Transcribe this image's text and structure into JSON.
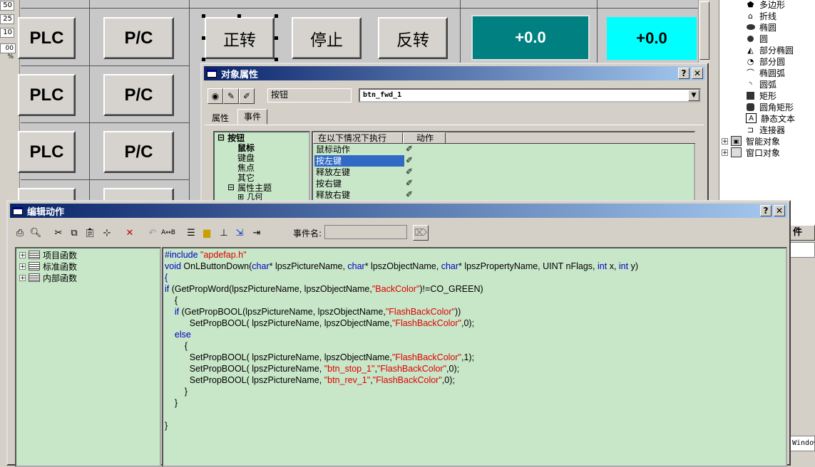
{
  "ruler": {
    "values": [
      "50",
      "25",
      "10",
      "00 %"
    ]
  },
  "canvas": {
    "left_buttons": [
      "PLC",
      "PLC",
      "PLC"
    ],
    "pc_buttons": [
      "P/C",
      "P/C",
      "P/C"
    ],
    "control_buttons": [
      "正转",
      "停止",
      "反转"
    ],
    "displays": [
      {
        "value": "+0.0",
        "color": "#008080"
      },
      {
        "value": "+0.0",
        "color": "#00ffff"
      }
    ]
  },
  "palette": {
    "items": [
      {
        "label": "多边形",
        "icon": "polygon-icon"
      },
      {
        "label": "折线",
        "icon": "polyline-icon"
      },
      {
        "label": "椭圆",
        "icon": "ellipse-icon"
      },
      {
        "label": "圆",
        "icon": "circle-icon"
      },
      {
        "label": "部分椭圆",
        "icon": "partial-ellipse-icon"
      },
      {
        "label": "部分圆",
        "icon": "partial-circle-icon"
      },
      {
        "label": "椭圆弧",
        "icon": "ellipse-arc-icon"
      },
      {
        "label": "圆弧",
        "icon": "arc-icon"
      },
      {
        "label": "矩形",
        "icon": "rectangle-icon"
      },
      {
        "label": "圆角矩形",
        "icon": "rounded-rectangle-icon"
      },
      {
        "label": "静态文本",
        "icon": "static-text-icon"
      },
      {
        "label": "连接器",
        "icon": "connector-icon"
      }
    ],
    "groups": [
      {
        "label": "智能对象"
      },
      {
        "label": "窗口对象"
      }
    ],
    "partial_tab": "件",
    "partial_window_label": "Window"
  },
  "object_props": {
    "title": "对象属性",
    "help_btn": "?",
    "close_btn": "✕",
    "object_type": "按钮",
    "object_name": "btn_fwd_1",
    "tabs": [
      "属性",
      "事件"
    ],
    "active_tab": "事件",
    "tree": {
      "root": "按钮",
      "children": [
        "鼠标",
        "键盘",
        "焦点",
        "其它",
        "属性主题"
      ],
      "sub": "几何"
    },
    "events_header": {
      "condition": "在以下情况下执行",
      "action": "动作"
    },
    "events": [
      "鼠标动作",
      "按左键",
      "释放左键",
      "按右键",
      "释放右键"
    ],
    "selected_event": "按左键"
  },
  "edit_action": {
    "title": "编辑动作",
    "help_btn": "?",
    "close_btn": "✕",
    "event_name_label": "事件名:",
    "event_name_value": "",
    "tree": [
      "项目函数",
      "标准函数",
      "内部函数"
    ],
    "code": [
      [
        [
          "d",
          "#include "
        ],
        [
          "s",
          "\"apdefap.h\""
        ]
      ],
      [
        [
          "k",
          "void"
        ],
        [
          "t",
          " OnLButtonDown("
        ],
        [
          "k",
          "char"
        ],
        [
          "t",
          "* lpszPictureName, "
        ],
        [
          "k",
          "char"
        ],
        [
          "t",
          "* lpszObjectName, "
        ],
        [
          "k",
          "char"
        ],
        [
          "t",
          "* lpszPropertyName, UINT nFlags, "
        ],
        [
          "k",
          "int"
        ],
        [
          "t",
          " x, "
        ],
        [
          "k",
          "int"
        ],
        [
          "t",
          " y)"
        ]
      ],
      [
        [
          "k",
          "{"
        ]
      ],
      [
        [
          "k",
          "if"
        ],
        [
          "t",
          " (GetPropWord(lpszPictureName, lpszObjectName,"
        ],
        [
          "s",
          "\"BackColor\""
        ],
        [
          "t",
          ")!=CO_GREEN)"
        ]
      ],
      [
        [
          "t",
          "    {"
        ]
      ],
      [
        [
          "t",
          "    "
        ],
        [
          "k",
          "if"
        ],
        [
          "t",
          " (GetPropBOOL(lpszPictureName, lpszObjectName,"
        ],
        [
          "s",
          "\"FlashBackColor\""
        ],
        [
          "t",
          "))"
        ]
      ],
      [
        [
          "t",
          "          SetPropBOOL( lpszPictureName, lpszObjectName,"
        ],
        [
          "s",
          "\"FlashBackColor\""
        ],
        [
          "t",
          ",0);"
        ]
      ],
      [
        [
          "t",
          "    "
        ],
        [
          "k",
          "else"
        ]
      ],
      [
        [
          "t",
          "        {"
        ]
      ],
      [
        [
          "t",
          "          SetPropBOOL( lpszPictureName, lpszObjectName,"
        ],
        [
          "s",
          "\"FlashBackColor\""
        ],
        [
          "t",
          ",1);"
        ]
      ],
      [
        [
          "t",
          "          SetPropBOOL( lpszPictureName, "
        ],
        [
          "s",
          "\"btn_stop_1\""
        ],
        [
          "t",
          ","
        ],
        [
          "s",
          "\"FlashBackColor\""
        ],
        [
          "t",
          ",0);"
        ]
      ],
      [
        [
          "t",
          "          SetPropBOOL( lpszPictureName, "
        ],
        [
          "s",
          "\"btn_rev_1\""
        ],
        [
          "t",
          ","
        ],
        [
          "s",
          "\"FlashBackColor\""
        ],
        [
          "t",
          ",0);"
        ]
      ],
      [
        [
          "t",
          "        }"
        ]
      ],
      [
        [
          "t",
          "    }"
        ]
      ],
      [
        [
          "t",
          ""
        ]
      ],
      [
        [
          "t",
          "}"
        ]
      ]
    ]
  }
}
